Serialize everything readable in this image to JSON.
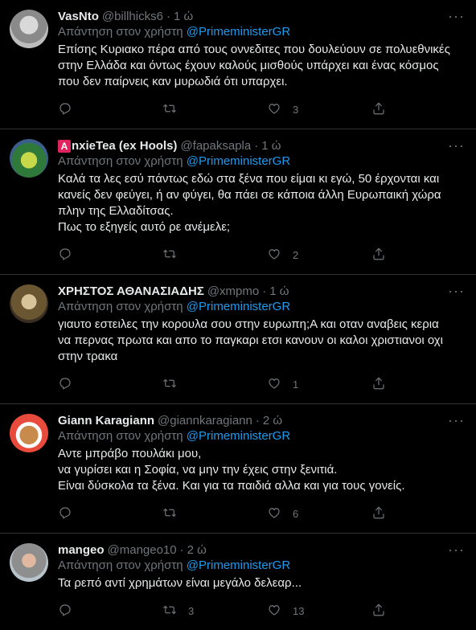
{
  "reply_prefix": "Απάντηση στον χρήστη",
  "tweets": [
    {
      "name": "VasNto",
      "handle": "@billhicks6",
      "time": "1 ώ",
      "mention": "@PrimeministerGR",
      "lines": [
        "Επίσης Κυριακο πέρα από τους οννεδιτες που δουλεύουν σε πολυεθνικές",
        "στην Ελλάδα και όντως έχουν καλούς μισθούς υπάρχει και ένας κόσμος",
        "που δεν παίρνεις καν μυρωδιά ότι υπαρχει."
      ],
      "replies": "",
      "retweets": "",
      "likes": "3"
    },
    {
      "name_badge": "A",
      "name": "nxieTea (ex Hools)",
      "handle": "@fapaksapla",
      "time": "1 ώ",
      "mention": "@PrimeministerGR",
      "lines": [
        "Καλά τα λες εσύ πάντως εδώ στα ξένα που είμαι κι εγώ, 50 έρχονται και",
        "κανείς δεν φεύγει, ή αν φύγει, θα πάει σε κάποια άλλη Ευρωπαική χώρα",
        "πλην της Ελλαδίτσας.",
        "Πως το εξηγείς αυτό ρε ανέμελε;"
      ],
      "replies": "",
      "retweets": "",
      "likes": "2"
    },
    {
      "name": "ΧΡΗΣΤΟΣ ΑΘΑΝΑΣΙΑΔΗΣ",
      "handle": "@xmpmo",
      "time": "1 ώ",
      "mention": "@PrimeministerGR",
      "lines": [
        "γιαυτο εστειλες την κορουλα σου στην ευρωπη;Α και οταν αναβεις κερια",
        "να περνας πρωτα και απο το παγκαρι ετσι κανουν οι καλοι χριστιανοι οχι",
        "στην τρακα"
      ],
      "replies": "",
      "retweets": "",
      "likes": "1"
    },
    {
      "name": "Giann Karagiann",
      "handle": "@giannkaragiann",
      "time": "2 ώ",
      "mention": "@PrimeministerGR",
      "lines": [
        "Αντε μπράβο πουλάκι μου,",
        "να γυρίσει και η Σοφία, να μην την έχεις στην ξενιτιά.",
        "Είναι δύσκολα τα ξένα. Και για τα παιδιά αλλα και για τους γονείς."
      ],
      "replies": "",
      "retweets": "",
      "likes": "6"
    },
    {
      "name": "mangeo",
      "handle": "@mangeo10",
      "time": "2 ώ",
      "mention": "@PrimeministerGR",
      "lines": [
        "Τα ρεπό αντί χρημάτων είναι μεγάλο δελεαρ..."
      ],
      "replies": "",
      "retweets": "3",
      "likes": "13"
    }
  ],
  "icons": [
    "reply-icon",
    "retweet-icon",
    "like-icon",
    "share-icon",
    "more-icon"
  ],
  "colors": {
    "background": "#000000",
    "text": "#e7e9ea",
    "muted": "#71767b",
    "mention": "#1d9bf0",
    "divider": "#2f3336"
  }
}
